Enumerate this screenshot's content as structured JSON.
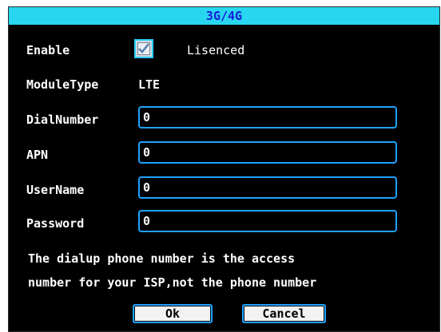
{
  "window": {
    "title": "3G/4G"
  },
  "enable": {
    "label": "Enable",
    "checked": true,
    "status": "Lisenced"
  },
  "module": {
    "label": "ModuleType",
    "value": "LTE"
  },
  "fields": {
    "dial_label": "DialNumber",
    "dial_value": "0",
    "apn_label": "APN",
    "apn_value": "0",
    "user_label": "UserName",
    "user_value": "0",
    "pass_label": "Password",
    "pass_value": "0"
  },
  "hint": {
    "line1": "The dialup phone number is the access",
    "line2": "number for your ISP,not the phone number"
  },
  "buttons": {
    "ok": "Ok",
    "cancel": "Cancel"
  },
  "colors": {
    "title_bg": "#28d6f0",
    "title_text": "#1a1ad8",
    "accent": "#1fa3ff",
    "background": "#000000"
  }
}
